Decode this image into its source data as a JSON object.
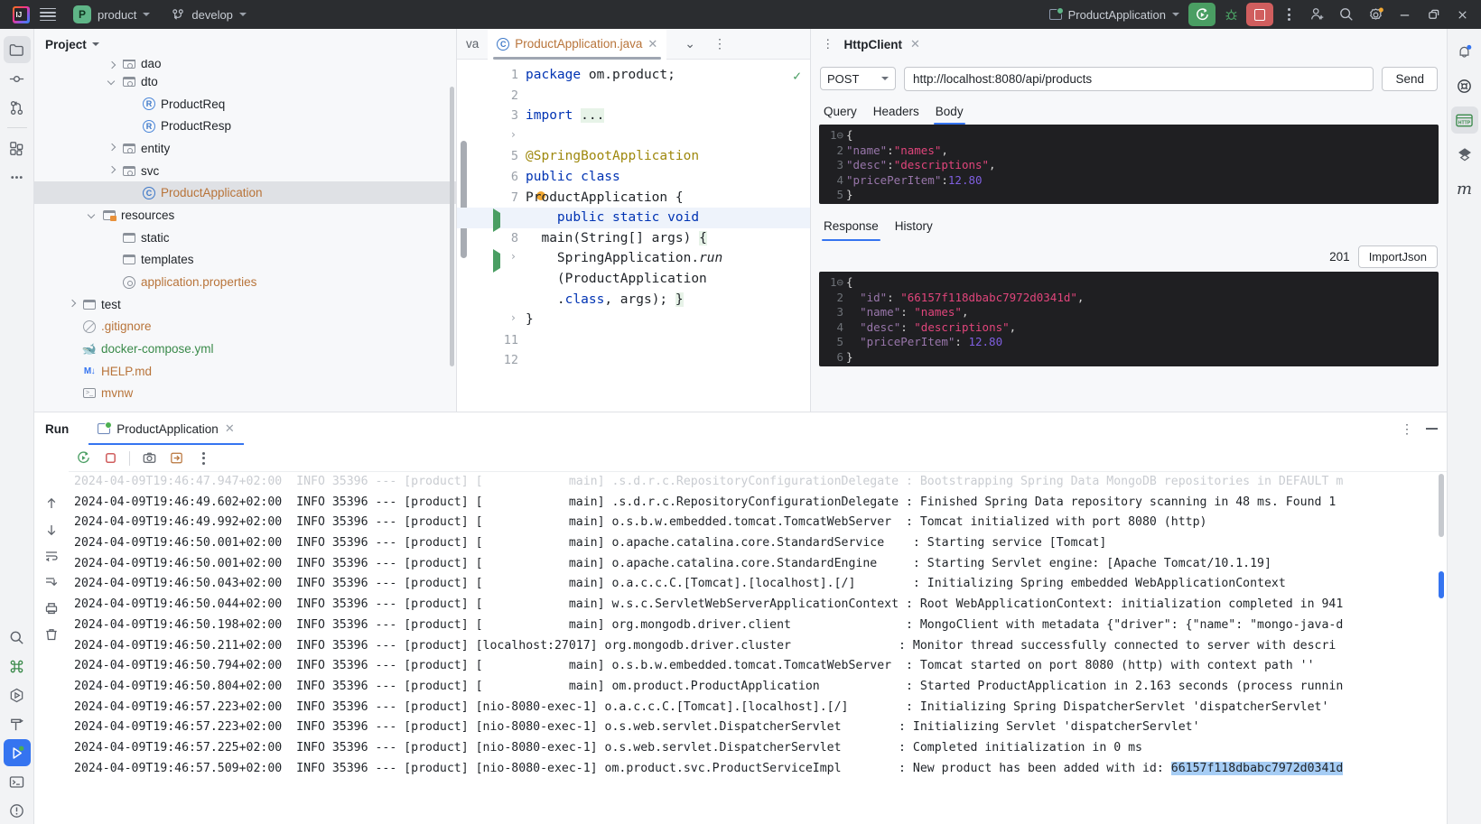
{
  "titlebar": {
    "logo_label": "IJ",
    "project_initial": "P",
    "project_name": "product",
    "branch_name": "develop",
    "run_config": "ProductApplication",
    "icons": {
      "menu": "hamburger-menu-icon",
      "vcs": "git-branch-icon",
      "run": "run-icon",
      "debug": "debug-bug-icon",
      "stop": "stop-icon",
      "more": "more-vertical-icon",
      "account": "user-add-icon",
      "search": "search-icon",
      "settings": "settings-gear-icon",
      "minimize": "minimize-icon",
      "maximize": "restore-window-icon",
      "close": "close-icon"
    }
  },
  "left_rail": {
    "top": [
      "project-folder-icon",
      "commit-icon",
      "pull-requests-icon",
      "services-icon",
      "more-tools-icon"
    ],
    "bottom": [
      "search-everywhere-icon",
      "command-icon",
      "run-anything-icon",
      "build-hammer-icon",
      "run-panel-icon",
      "terminal-icon",
      "problems-icon"
    ]
  },
  "right_rail": {
    "items": [
      "notifications-bell-icon",
      "mongodb-icon",
      "http-client-icon",
      "gradle-icon",
      "maven-icon"
    ]
  },
  "project": {
    "title": "Project",
    "tree": [
      {
        "label": "dao",
        "indent": 3,
        "arrow": "right",
        "icon": "package-folder-icon",
        "color": "normal",
        "partial": true
      },
      {
        "label": "dto",
        "indent": 3,
        "arrow": "down",
        "icon": "package-folder-icon",
        "color": "normal"
      },
      {
        "label": "ProductReq",
        "indent": 4,
        "arrow": "none",
        "icon": "record-class-icon",
        "color": "normal"
      },
      {
        "label": "ProductResp",
        "indent": 4,
        "arrow": "none",
        "icon": "record-class-icon",
        "color": "normal"
      },
      {
        "label": "entity",
        "indent": 3,
        "arrow": "right",
        "icon": "package-folder-icon",
        "color": "normal"
      },
      {
        "label": "svc",
        "indent": 3,
        "arrow": "right",
        "icon": "package-folder-icon",
        "color": "normal"
      },
      {
        "label": "ProductApplication",
        "indent": 4,
        "arrow": "none",
        "icon": "java-class-icon",
        "color": "orange",
        "selected": true
      },
      {
        "label": "resources",
        "indent": 2,
        "arrow": "down",
        "icon": "resources-folder-icon",
        "color": "normal"
      },
      {
        "label": "static",
        "indent": 3,
        "arrow": "none",
        "icon": "folder-icon",
        "color": "normal"
      },
      {
        "label": "templates",
        "indent": 3,
        "arrow": "none",
        "icon": "folder-icon",
        "color": "normal"
      },
      {
        "label": "application.properties",
        "indent": 3,
        "arrow": "none",
        "icon": "properties-icon",
        "color": "orange"
      },
      {
        "label": "test",
        "indent": 1,
        "arrow": "right",
        "icon": "folder-icon",
        "color": "normal"
      },
      {
        "label": ".gitignore",
        "indent": 1,
        "arrow": "none",
        "icon": "gitignore-icon",
        "color": "orange"
      },
      {
        "label": "docker-compose.yml",
        "indent": 1,
        "arrow": "none",
        "icon": "docker-icon",
        "color": "green"
      },
      {
        "label": "HELP.md",
        "indent": 1,
        "arrow": "none",
        "icon": "markdown-icon",
        "color": "orange"
      },
      {
        "label": "mvnw",
        "indent": 1,
        "arrow": "none",
        "icon": "shell-script-icon",
        "color": "orange"
      }
    ]
  },
  "editor": {
    "tab_partial": "va",
    "tab_active": "ProductApplication.java",
    "close_glyph": "✕",
    "chevron_glyph": "⌄",
    "kebab_glyph": "⋮",
    "gutter_lines": [
      "1",
      "2",
      "3",
      "",
      "5",
      "6",
      "7",
      "",
      "8",
      "",
      "",
      "",
      "",
      "11",
      "12"
    ],
    "code_lines": [
      "package om.product;",
      "",
      "import ...",
      "",
      "@SpringBootApplication",
      "public class",
      "ProductApplication {",
      "    public static void",
      "  main(String[] args) {",
      "    SpringApplication.run",
      "    (ProductApplication",
      "    .class, args); }",
      "}",
      ""
    ]
  },
  "http_client": {
    "panel_title": "HttpClient",
    "close_glyph": "✕",
    "kebab_glyph": "⋮",
    "method": "POST",
    "url": "http://localhost:8080/api/products",
    "send_label": "Send",
    "request_tabs": [
      "Query",
      "Headers",
      "Body"
    ],
    "request_active_tab": "Body",
    "request_body_lines": [
      "1",
      "2",
      "3",
      "4",
      "5"
    ],
    "request_body": {
      "name_key": "\"name\"",
      "name_val": "\"names\"",
      "desc_key": "\"desc\"",
      "desc_val": "\"descriptions\"",
      "price_key": "\"pricePerItem\"",
      "price_val": "12.80"
    },
    "response_tabs": [
      "Response",
      "History"
    ],
    "response_active_tab": "Response",
    "status_code": "201",
    "import_label": "ImportJson",
    "response_body_lines": [
      "1",
      "2",
      "3",
      "4",
      "5",
      "6"
    ],
    "response_body": {
      "id_key": "\"id\"",
      "id_val": "\"66157f118dbabc7972d0341d\"",
      "name_key": "\"name\"",
      "name_val": "\"names\"",
      "desc_key": "\"desc\"",
      "desc_val": "\"descriptions\"",
      "price_key": "\"pricePerItem\"",
      "price_val": "12.80"
    }
  },
  "run_panel": {
    "label": "Run",
    "tab_name": "ProductApplication",
    "close_glyph": "✕",
    "kebab_glyph": "⋮",
    "toolbar_icons": [
      "rerun-icon",
      "stop-icon",
      "camera-snapshot-icon",
      "export-icon",
      "more-vertical-icon"
    ],
    "side_icons": [
      "scroll-up-icon",
      "scroll-down-icon",
      "soft-wrap-icon",
      "scroll-to-end-icon",
      "print-icon",
      "clear-all-icon"
    ],
    "console_lines": [
      {
        "ts": "2024-04-09T19:46:47.947+02:00",
        "level": "INFO",
        "pid": "35396",
        "app": "[product]",
        "thread": "[            main]",
        "logger": ".s.d.r.c.RepositoryConfigurationDelegate",
        "msg": ": Bootstrapping Spring Data MongoDB repositories in DEFAULT m",
        "faded": true
      },
      {
        "ts": "2024-04-09T19:46:49.602+02:00",
        "level": "INFO",
        "pid": "35396",
        "app": "[product]",
        "thread": "[            main]",
        "logger": ".s.d.r.c.RepositoryConfigurationDelegate",
        "msg": ": Finished Spring Data repository scanning in 48 ms. Found 1 "
      },
      {
        "ts": "2024-04-09T19:46:49.992+02:00",
        "level": "INFO",
        "pid": "35396",
        "app": "[product]",
        "thread": "[            main]",
        "logger": "o.s.b.w.embedded.tomcat.TomcatWebServer ",
        "msg": ": Tomcat initialized with port 8080 (http)"
      },
      {
        "ts": "2024-04-09T19:46:50.001+02:00",
        "level": "INFO",
        "pid": "35396",
        "app": "[product]",
        "thread": "[            main]",
        "logger": "o.apache.catalina.core.StandardService   ",
        "msg": ": Starting service [Tomcat]"
      },
      {
        "ts": "2024-04-09T19:46:50.001+02:00",
        "level": "INFO",
        "pid": "35396",
        "app": "[product]",
        "thread": "[            main]",
        "logger": "o.apache.catalina.core.StandardEngine    ",
        "msg": ": Starting Servlet engine: [Apache Tomcat/10.1.19]"
      },
      {
        "ts": "2024-04-09T19:46:50.043+02:00",
        "level": "INFO",
        "pid": "35396",
        "app": "[product]",
        "thread": "[            main]",
        "logger": "o.a.c.c.C.[Tomcat].[localhost].[/]       ",
        "msg": ": Initializing Spring embedded WebApplicationContext"
      },
      {
        "ts": "2024-04-09T19:46:50.044+02:00",
        "level": "INFO",
        "pid": "35396",
        "app": "[product]",
        "thread": "[            main]",
        "logger": "w.s.c.ServletWebServerApplicationContext",
        "msg": ": Root WebApplicationContext: initialization completed in 941"
      },
      {
        "ts": "2024-04-09T19:46:50.198+02:00",
        "level": "INFO",
        "pid": "35396",
        "app": "[product]",
        "thread": "[            main]",
        "logger": "org.mongodb.driver.client               ",
        "msg": ": MongoClient with metadata {\"driver\": {\"name\": \"mongo-java-d"
      },
      {
        "ts": "2024-04-09T19:46:50.211+02:00",
        "level": "INFO",
        "pid": "35396",
        "app": "[product]",
        "thread": "[localhost:27017]",
        "logger": "org.mongodb.driver.cluster              ",
        "msg": ": Monitor thread successfully connected to server with descri"
      },
      {
        "ts": "2024-04-09T19:46:50.794+02:00",
        "level": "INFO",
        "pid": "35396",
        "app": "[product]",
        "thread": "[            main]",
        "logger": "o.s.b.w.embedded.tomcat.TomcatWebServer ",
        "msg": ": Tomcat started on port 8080 (http) with context path ''"
      },
      {
        "ts": "2024-04-09T19:46:50.804+02:00",
        "level": "INFO",
        "pid": "35396",
        "app": "[product]",
        "thread": "[            main]",
        "logger": "om.product.ProductApplication           ",
        "msg": ": Started ProductApplication in 2.163 seconds (process runnin"
      },
      {
        "ts": "2024-04-09T19:46:57.223+02:00",
        "level": "INFO",
        "pid": "35396",
        "app": "[product]",
        "thread": "[nio-8080-exec-1]",
        "logger": "o.a.c.c.C.[Tomcat].[localhost].[/]       ",
        "msg": ": Initializing Spring DispatcherServlet 'dispatcherServlet'"
      },
      {
        "ts": "2024-04-09T19:46:57.223+02:00",
        "level": "INFO",
        "pid": "35396",
        "app": "[product]",
        "thread": "[nio-8080-exec-1]",
        "logger": "o.s.web.servlet.DispatcherServlet       ",
        "msg": ": Initializing Servlet 'dispatcherServlet'"
      },
      {
        "ts": "2024-04-09T19:46:57.225+02:00",
        "level": "INFO",
        "pid": "35396",
        "app": "[product]",
        "thread": "[nio-8080-exec-1]",
        "logger": "o.s.web.servlet.DispatcherServlet       ",
        "msg": ": Completed initialization in 0 ms"
      },
      {
        "ts": "2024-04-09T19:46:57.509+02:00",
        "level": "INFO",
        "pid": "35396",
        "app": "[product]",
        "thread": "[nio-8080-exec-1]",
        "logger": "om.product.svc.ProductServiceImpl       ",
        "msg": ": New product has been added with id: ",
        "selected_text": "66157f118dbabc7972d0341d"
      }
    ]
  },
  "colors": {
    "titlebar_bg": "#2b2d30",
    "accent_blue": "#3574f0",
    "run_green": "#4a9e63",
    "stop_red": "#d05e5e",
    "panel_bg": "#f7f8fa",
    "code_bg": "#1f1f22",
    "selection_blue": "#a6cdf5"
  }
}
